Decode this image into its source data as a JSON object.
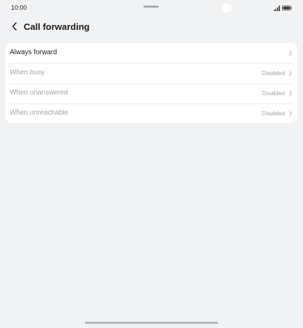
{
  "status_bar": {
    "time": "10:00",
    "icons": [
      "signal-icon",
      "battery-icon"
    ]
  },
  "header": {
    "back_icon": "chevron-left-icon",
    "title": "Call forwarding"
  },
  "settings": {
    "items": [
      {
        "label": "Always forward",
        "value": "",
        "enabled": true
      },
      {
        "label": "When busy",
        "value": "Disabled",
        "enabled": false
      },
      {
        "label": "When unanswered",
        "value": "Disabled",
        "enabled": false
      },
      {
        "label": "When unreachable",
        "value": "Disabled",
        "enabled": false
      }
    ]
  },
  "colors": {
    "background": "#f1f2f4",
    "card": "#ffffff",
    "text_primary": "#1e1e1e",
    "text_disabled": "#a2a4a8"
  }
}
